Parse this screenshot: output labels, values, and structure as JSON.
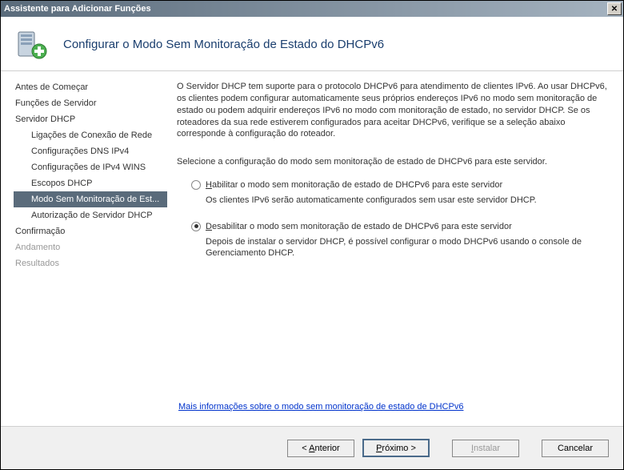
{
  "window": {
    "title": "Assistente para Adicionar Funções"
  },
  "header": {
    "title": "Configurar o Modo Sem Monitoração de Estado do DHCPv6"
  },
  "sidebar": {
    "items": [
      {
        "label": "Antes de Começar"
      },
      {
        "label": "Funções de Servidor"
      },
      {
        "label": "Servidor DHCP"
      },
      {
        "label": "Ligações de Conexão de Rede"
      },
      {
        "label": "Configurações DNS IPv4"
      },
      {
        "label": "Configurações de IPv4 WINS"
      },
      {
        "label": "Escopos DHCP"
      },
      {
        "label": "Modo Sem Monitoração de Est..."
      },
      {
        "label": "Autorização de Servidor DHCP"
      },
      {
        "label": "Confirmação"
      },
      {
        "label": "Andamento"
      },
      {
        "label": "Resultados"
      }
    ]
  },
  "content": {
    "intro": "O Servidor DHCP tem suporte para o protocolo DHCPv6 para atendimento de clientes IPv6. Ao usar DHCPv6, os clientes podem configurar automaticamente seus próprios endereços IPv6 no modo sem monitoração de estado ou podem adquirir endereços IPv6 no modo com monitoração de estado, no servidor DHCP. Se os roteadores da sua rede estiverem configurados para aceitar DHCPv6, verifique se a seleção abaixo corresponde à configuração do roteador.",
    "select_prompt": "Selecione a configuração do modo sem monitoração de estado de DHCPv6 para este servidor.",
    "option1": {
      "prefix": "H",
      "rest": "abilitar o modo sem monitoração de estado de DHCPv6 para este servidor",
      "desc": "Os clientes IPv6 serão automaticamente configurados sem usar este servidor DHCP."
    },
    "option2": {
      "prefix": "D",
      "rest": "esabilitar o modo sem monitoração de estado de DHCPv6 para este servidor",
      "desc": "Depois de instalar o servidor DHCP, é possível configurar o modo DHCPv6 usando o console de Gerenciamento DHCP."
    },
    "link": "Mais informações sobre o modo sem monitoração de estado de DHCPv6"
  },
  "footer": {
    "back_prefix": "< ",
    "back_u": "A",
    "back_rest": "nterior",
    "next_prefix": "",
    "next_u": "P",
    "next_rest": "róximo >",
    "install_u": "I",
    "install_rest": "nstalar",
    "cancel": "Cancelar"
  }
}
